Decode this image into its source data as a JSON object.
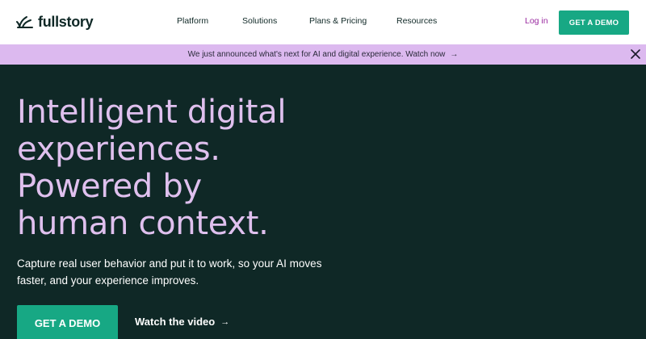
{
  "header": {
    "logo_text": "fullstory",
    "nav": {
      "platform": "Platform",
      "solutions": "Solutions",
      "pricing": "Plans & Pricing",
      "resources": "Resources"
    },
    "login": "Log in",
    "demo_button": "GET A DEMO"
  },
  "banner": {
    "text": "We just announced what's next for AI and digital experience. Watch now",
    "arrow": "→",
    "close_icon": "close-icon"
  },
  "hero": {
    "headline": {
      "line1": "Intelligent digital",
      "line2": "experiences.",
      "line3": "Powered by",
      "line4": "human context."
    },
    "subtext": "Capture real user behavior and put it to work, so your AI moves faster, and your experience improves.",
    "demo_button": "GET A DEMO",
    "watch_link": "Watch the video",
    "watch_arrow": "→"
  },
  "colors": {
    "hero_bg": "#0f2826",
    "accent_green": "#17a884",
    "banner_bg": "#dcb9ef",
    "headline": "#dfc0ee",
    "login_link": "#9a2aa0"
  }
}
